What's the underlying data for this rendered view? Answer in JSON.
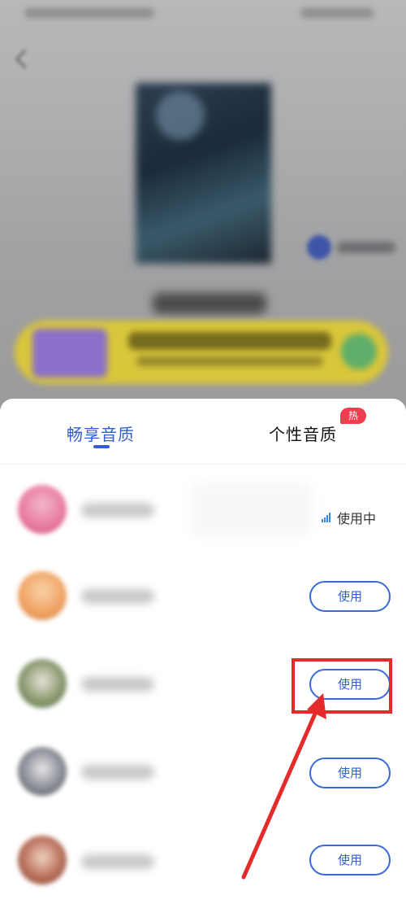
{
  "tabs": {
    "enjoy_quality": "畅享音质",
    "personal_quality": "个性音质",
    "hot_badge": "热"
  },
  "voices": {
    "in_use_label": "使用中",
    "use_label": "使用",
    "items": [
      {
        "status": "in-use",
        "avatar_color": "#e879a0"
      },
      {
        "status": "available",
        "avatar_color": "#f0a060"
      },
      {
        "status": "available",
        "avatar_color": "#6a8e5a"
      },
      {
        "status": "available",
        "avatar_color": "#6c6e76"
      },
      {
        "status": "available",
        "avatar_color": "#a85a4a"
      }
    ]
  },
  "colors": {
    "accent": "#2f5fd0",
    "hot": "#ee3d4f",
    "annotation": "#e52a2a"
  },
  "icons": {
    "in_use_indicator": "signal-bars-icon",
    "annotation": "red-arrow"
  }
}
